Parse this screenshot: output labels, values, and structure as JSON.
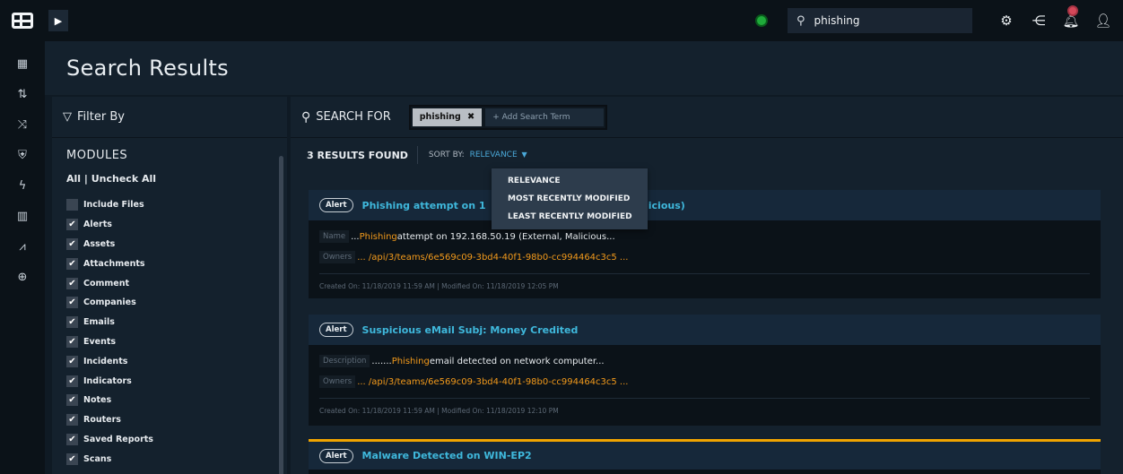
{
  "topbar": {
    "search_value": "phishing",
    "icons": [
      "app-logo-icon",
      "expand-icon",
      "status-icon",
      "search-icon",
      "gear-icon",
      "network-icon",
      "bell-icon",
      "user-icon"
    ]
  },
  "rail": {
    "icons": [
      "dashboard-icon",
      "sort-icon",
      "shuffle-icon",
      "shield-icon",
      "lightning-icon",
      "briefcase-icon",
      "chart-icon",
      "globe-icon"
    ]
  },
  "page": {
    "title": "Search Results"
  },
  "filter": {
    "heading": "Filter By",
    "modules_label": "MODULES",
    "check_all": "All | Uncheck All",
    "modules": [
      {
        "label": "Include Files",
        "checked": false
      },
      {
        "label": "Alerts",
        "checked": true
      },
      {
        "label": "Assets",
        "checked": true
      },
      {
        "label": "Attachments",
        "checked": true
      },
      {
        "label": "Comment",
        "checked": true
      },
      {
        "label": "Companies",
        "checked": true
      },
      {
        "label": "Emails",
        "checked": true
      },
      {
        "label": "Events",
        "checked": true
      },
      {
        "label": "Incidents",
        "checked": true
      },
      {
        "label": "Indicators",
        "checked": true
      },
      {
        "label": "Notes",
        "checked": true
      },
      {
        "label": "Routers",
        "checked": true
      },
      {
        "label": "Saved Reports",
        "checked": true
      },
      {
        "label": "Scans",
        "checked": true
      }
    ]
  },
  "search": {
    "label": "SEARCH FOR",
    "term": "phishing",
    "add_term": "+ Add Search Term",
    "results_found": "3 RESULTS FOUND",
    "sort_label": "SORT BY:",
    "sort_value": "RELEVANCE",
    "sort_options": [
      "RELEVANCE",
      "MOST RECENTLY MODIFIED",
      "LEAST RECENTLY MODIFIED"
    ]
  },
  "results": [
    {
      "type": "Alert",
      "title": "Phishing attempt on 1",
      "title_tail": "alicious)",
      "field1_label": "Name",
      "field1_prefix": "... ",
      "field1_hl": "Phishing",
      "field1_rest": " attempt on 192.168.50.19 (External, Malicious...",
      "field2_label": "Owners",
      "field2_value": "... /api/3/teams/6e569c09-3bd4-40f1-98b0-cc994464c3c5 ...",
      "meta": "Created On:  11/18/2019 11:59 AM   |   Modified On:  11/18/2019 12:05 PM"
    },
    {
      "type": "Alert",
      "title": "Suspicious eMail Subj: Money Credited",
      "field1_label": "Description",
      "field1_prefix": " ....... ",
      "field1_hl": "Phishing",
      "field1_rest": " email detected on network computer...",
      "field2_label": "Owners",
      "field2_value": "... /api/3/teams/6e569c09-3bd4-40f1-98b0-cc994464c3c5 ...",
      "meta": "Created On:  11/18/2019 11:59 AM   |   Modified On:  11/18/2019 12:10 PM"
    },
    {
      "type": "Alert",
      "title": "Malware Detected on WIN-EP2"
    }
  ],
  "colors": {
    "accent": "#3fb8dc",
    "highlight": "#f39a1b",
    "status_green": "#1faa3a",
    "selected_border": "#f0a400"
  }
}
